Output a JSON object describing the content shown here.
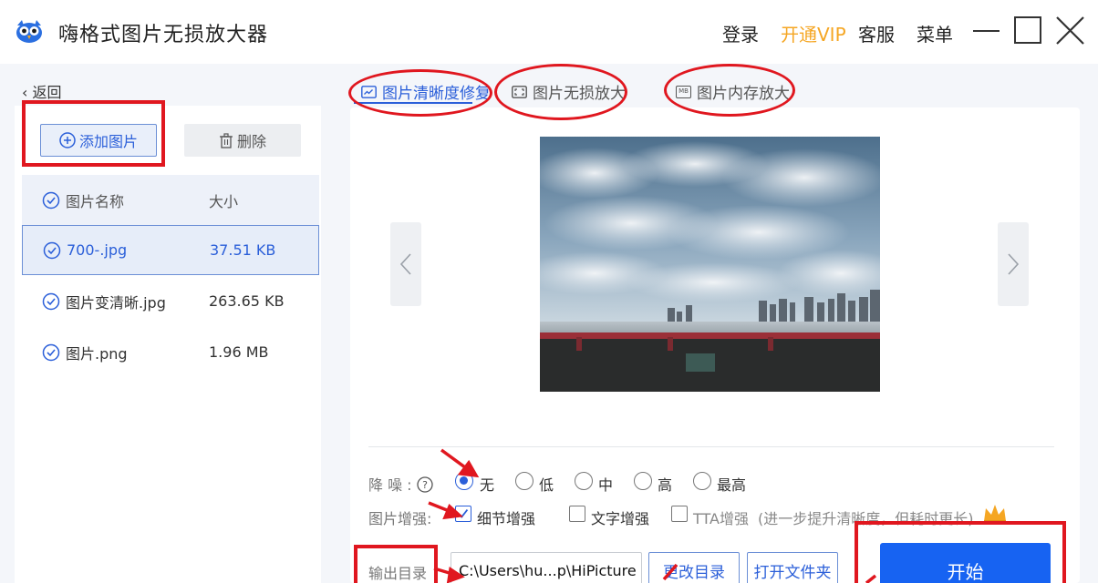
{
  "titlebar": {
    "app_title": "嗨格式图片无损放大器",
    "login": "登录",
    "vip": "开通VIP",
    "service": "客服",
    "menu": "菜单"
  },
  "left": {
    "back": "返回",
    "add_button": "添加图片",
    "delete_button": "删除",
    "header_name": "图片名称",
    "header_size": "大小",
    "files": [
      {
        "name": "700-.jpg",
        "size": "37.51 KB"
      },
      {
        "name": "图片变清晰.jpg",
        "size": "263.65 KB"
      },
      {
        "name": "图片.png",
        "size": "1.96 MB"
      }
    ]
  },
  "tabs": [
    {
      "label": "图片清晰度修复",
      "icon": "enhance-icon"
    },
    {
      "label": "图片无损放大",
      "icon": "expand-icon"
    },
    {
      "label": "图片内存放大",
      "icon": "mb-icon",
      "icon_text": "MB"
    }
  ],
  "options": {
    "denoise_label": "降 噪 :",
    "denoise_levels": [
      "无",
      "低",
      "中",
      "高",
      "最高"
    ],
    "denoise_selected": "无",
    "enhance_label": "图片增强:",
    "enhance_options": [
      "细节增强",
      "文字增强",
      "TTA增强"
    ],
    "enhance_checked": [
      "细节增强"
    ],
    "tta_hint": "(进一步提升清晰度，但耗时更长)"
  },
  "output": {
    "label": "输出目录",
    "path": "C:\\Users\\hu...p\\HiPicture",
    "change_button": "更改目录",
    "open_button": "打开文件夹"
  },
  "start_button": "开始",
  "colors": {
    "accent": "#2b5fd9",
    "vip": "#f5a623",
    "start": "#1763f2",
    "annotation": "#e0171f"
  }
}
